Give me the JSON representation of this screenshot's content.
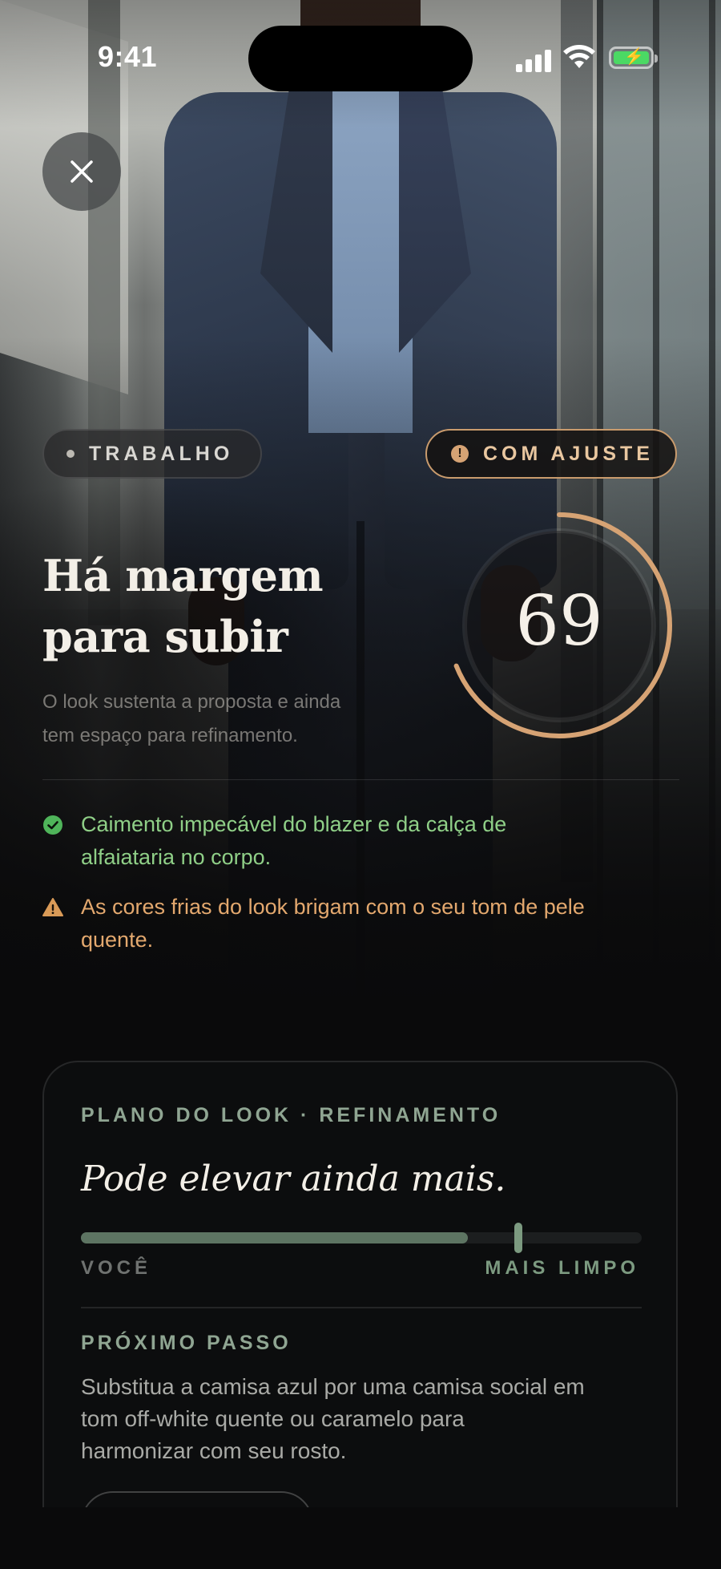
{
  "status_bar": {
    "time": "9:41",
    "battery_color": "#4bd964"
  },
  "close_button": {
    "icon": "close-icon"
  },
  "tags": {
    "occasion": "TRABALHO",
    "status": "COM AJUSTE",
    "status_color": "#c99b6d"
  },
  "verdict": {
    "title_line1": "Há margem",
    "title_line2": "para subir",
    "description_line1": "O look sustenta a proposta e ainda",
    "description_line2": "tem espaço para refinamento.",
    "score": "69",
    "score_value": 69,
    "score_max": 100,
    "ring_color": "#d6a374"
  },
  "notes": [
    {
      "type": "positive",
      "icon": "check-circle-icon",
      "line1": "Caimento impecável do blazer e da calça de",
      "line2": "alfaiataria no corpo.",
      "color": "#8fcf87"
    },
    {
      "type": "warning",
      "icon": "warning-triangle-icon",
      "line1": "As cores frias do look brigam com o seu tom de pele",
      "line2": "quente.",
      "color": "#e3a86e"
    }
  ],
  "plan": {
    "eyebrow": "PLANO DO LOOK · REFINAMENTO",
    "title": "Pode elevar ainda mais.",
    "progress": 0.69,
    "target": 0.78,
    "label_you": "VOCÊ",
    "label_target": "MAIS LIMPO",
    "next_step_label": "PRÓXIMO PASSO",
    "next_step_line1": "Substitua a camisa azul por uma camisa social em",
    "next_step_line2": "tom off-white quente ou caramelo para",
    "next_step_line3": "harmonizar com seu rosto.",
    "accent_color": "#7c9a80"
  }
}
